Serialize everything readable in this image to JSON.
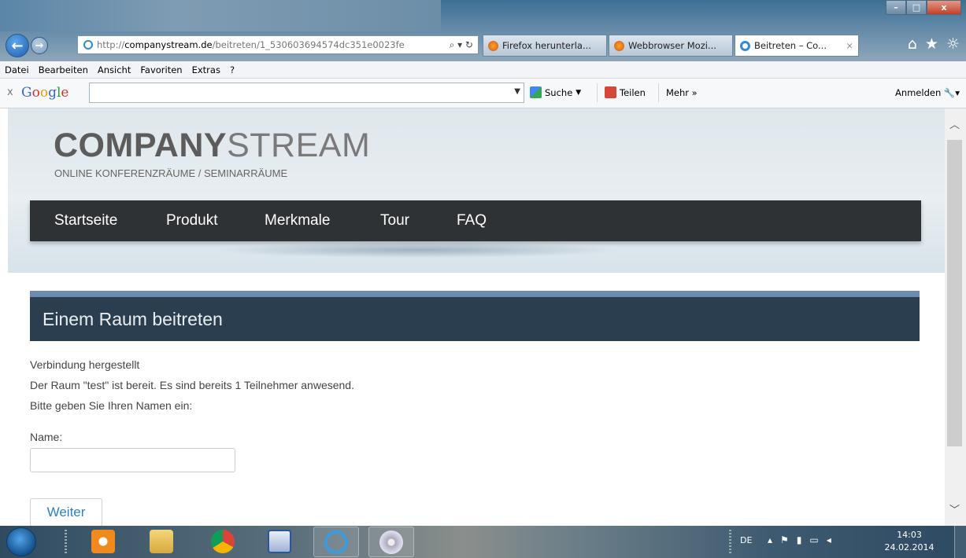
{
  "browser": {
    "url_prefix": "http://",
    "url_domain": "companystream.de",
    "url_path": "/beitreten/1_530603694574dc351e0023fe",
    "address_controls": "⌕ ▾ ↻",
    "tabs": [
      {
        "label": "Firefox herunterla...",
        "active": false
      },
      {
        "label": "Webbrowser Mozi...",
        "active": false
      },
      {
        "label": "Beitreten – Co...",
        "active": true,
        "close": "×"
      }
    ],
    "window_controls": {
      "min": "–",
      "max": "□",
      "close": "x"
    }
  },
  "menubar": {
    "items": [
      "Datei",
      "Bearbeiten",
      "Ansicht",
      "Favoriten",
      "Extras",
      "?"
    ]
  },
  "google_toolbar": {
    "close": "x",
    "logo": "Google",
    "search_value": "",
    "search_label": "Suche",
    "share_label": "Teilen",
    "more_label": "Mehr »",
    "signin_label": "Anmelden"
  },
  "site": {
    "logo_bold": "COMPANY",
    "logo_light": "STREAM",
    "tagline": "ONLINE KONFERENZRÄUME / SEMINARRÄUME",
    "nav": [
      "Startseite",
      "Produkt",
      "Merkmale",
      "Tour",
      "FAQ"
    ],
    "join_title": "Einem Raum beitreten",
    "status_line": "Verbindung hergestellt",
    "room_line": "Der Raum \"test\" ist bereit. Es sind bereits 1 Teilnehmer anwesend.",
    "prompt_line": "Bitte geben Sie Ihren Namen ein:",
    "name_label": "Name:",
    "name_value": "",
    "submit_label": "Weiter"
  },
  "taskbar": {
    "language": "DE",
    "time": "14:03",
    "date": "24.02.2014"
  },
  "colors": {
    "nav_bg": "#2f3234",
    "join_bar_bg": "#2b3e50",
    "join_bar_accent": "#6b8aad",
    "button_text": "#2d7fc0"
  }
}
